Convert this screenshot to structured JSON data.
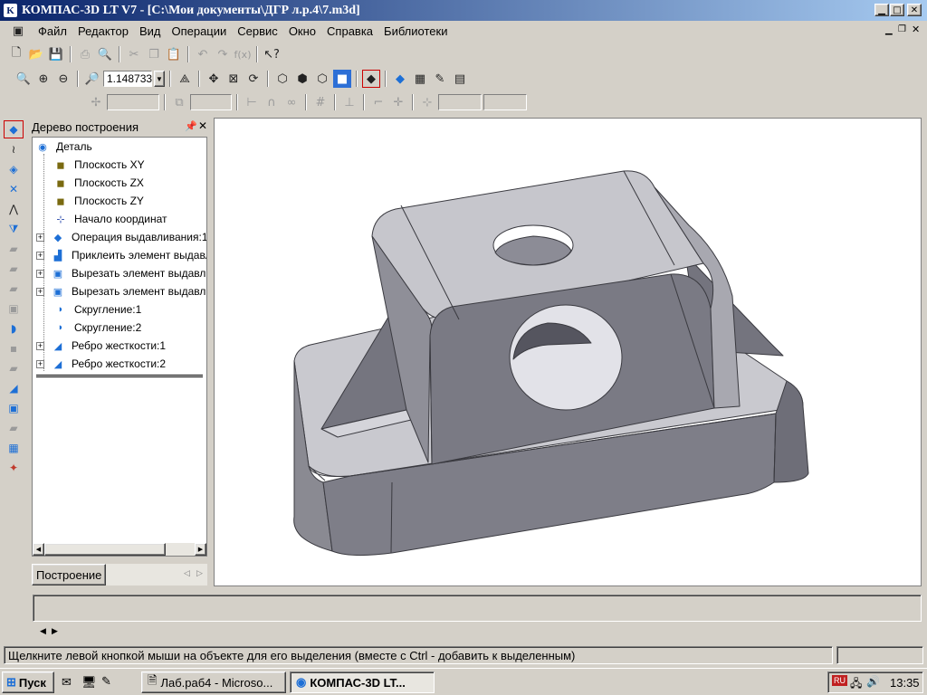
{
  "window": {
    "title": "КОМПАС-3D LT V7 - [C:\\Мои документы\\ДГР л.р.4\\7.m3d]"
  },
  "menu": [
    "Файл",
    "Редактор",
    "Вид",
    "Операции",
    "Сервис",
    "Окно",
    "Справка",
    "Библиотеки"
  ],
  "toolbar": {
    "zoom_value": "1.148733"
  },
  "tree": {
    "title": "Дерево построения",
    "root": "Деталь",
    "items": [
      {
        "label": "Плоскость XY"
      },
      {
        "label": "Плоскость ZX"
      },
      {
        "label": "Плоскость ZY"
      },
      {
        "label": "Начало координат"
      },
      {
        "label": "Операция выдавливания:1"
      },
      {
        "label": "Приклеить элемент выдавл"
      },
      {
        "label": "Вырезать элемент выдавли"
      },
      {
        "label": "Вырезать элемент выдавли"
      },
      {
        "label": "Скругление:1"
      },
      {
        "label": "Скругление:2"
      },
      {
        "label": "Ребро жесткости:1"
      },
      {
        "label": "Ребро жесткости:2"
      }
    ],
    "tab": "Построение"
  },
  "status_text": "Щелкните левой кнопкой мыши на объекте для его выделения (вместе с Ctrl - добавить к выделенным)",
  "taskbar": {
    "start": "Пуск",
    "tasks": [
      "Лаб.раб4 - Microso...",
      "КОМПАС-3D LT..."
    ],
    "lang": "RU",
    "clock": "13:35"
  },
  "colors": {
    "title_start": "#0a246a",
    "title_end": "#a6caf0",
    "model_top": "#c6c6cc",
    "model_side": "#84848c",
    "model_dark": "#6e6e78"
  }
}
